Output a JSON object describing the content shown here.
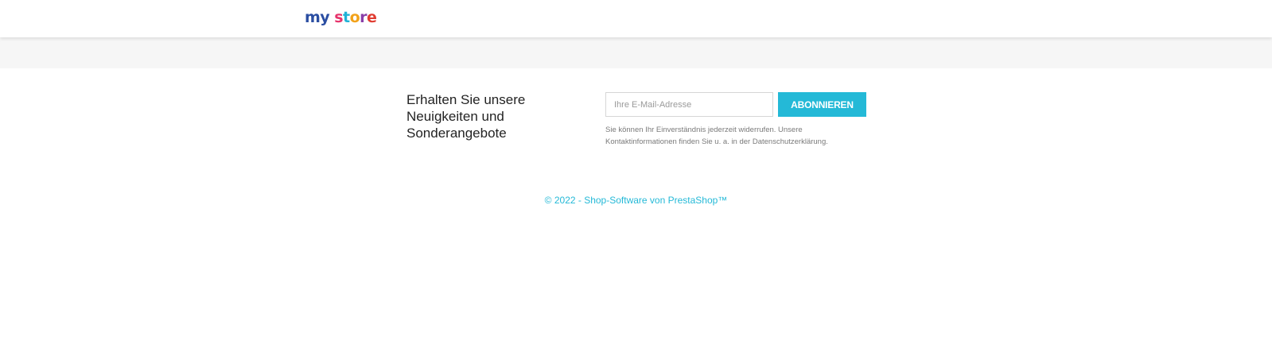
{
  "header": {
    "logo": {
      "text_my": "my",
      "text_store": "store",
      "colors": {
        "my": "#2b4ea2",
        "s": "#e6336b",
        "t": "#20b2d6",
        "o": "#f2a21a",
        "r": "#8a3fa8",
        "e": "#e03c31"
      }
    }
  },
  "newsletter": {
    "title": "Erhalten Sie unsere Neuigkeiten und Sonderangebote",
    "email_placeholder": "Ihre E-Mail-Adresse",
    "email_value": "",
    "subscribe_label": "ABONNIEREN",
    "consent_text": "Sie können Ihr Einverständnis jederzeit widerrufen. Unsere Kontaktinformationen finden Sie u. a. in der Datenschutzerklärung."
  },
  "footer": {
    "copyright": "© 2022 - Shop-Software von PrestaShop™"
  },
  "colors": {
    "accent": "#24b9d7",
    "band": "#f6f6f6",
    "text": "#232323",
    "muted": "#7a7a7a"
  }
}
